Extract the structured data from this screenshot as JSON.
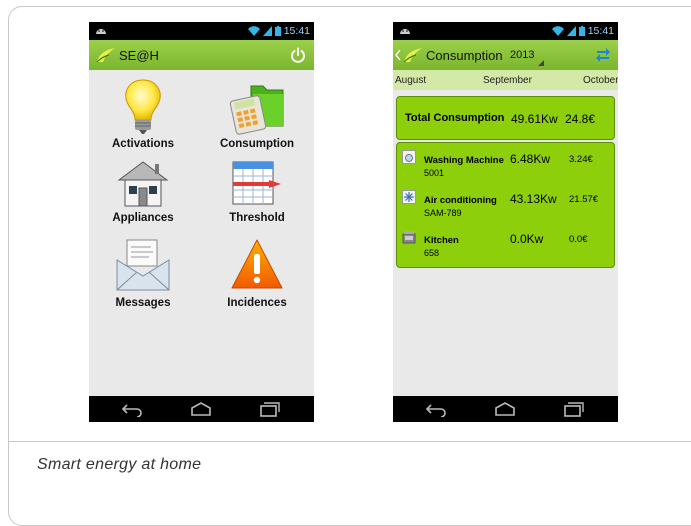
{
  "caption": "Smart energy at home",
  "status": {
    "time": "15:41"
  },
  "home": {
    "title": "SE@H",
    "tiles": [
      {
        "label": "Activations"
      },
      {
        "label": "Consumption"
      },
      {
        "label": "Appliances"
      },
      {
        "label": "Threshold"
      },
      {
        "label": "Messages"
      },
      {
        "label": "Incidences"
      }
    ]
  },
  "consumption": {
    "title": "Consumption",
    "year": "2013",
    "months": {
      "prev": "August",
      "current": "September",
      "next": "October"
    },
    "total": {
      "label": "Total Consumption",
      "kw": "49.61Kw",
      "eur": "24.8€"
    },
    "rows": [
      {
        "name": "Washing Machine",
        "id": "5001",
        "kw": "6.48Kw",
        "eur": "3.24€",
        "icon": "washing-machine-icon"
      },
      {
        "name": "Air conditioning",
        "id": "SAM-789",
        "kw": "43.13Kw",
        "eur": "21.57€",
        "icon": "snowflake-icon"
      },
      {
        "name": "Kitchen",
        "id": "658",
        "kw": "0.0Kw",
        "eur": "0.0€",
        "icon": "kitchen-icon"
      }
    ]
  },
  "colors": {
    "accent": "#8ccf0a",
    "appbar": "#8bc23c"
  }
}
